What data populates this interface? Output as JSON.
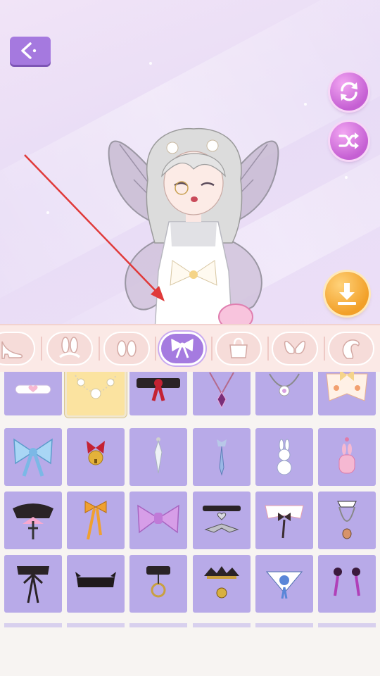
{
  "screen": {
    "back_icon": "back-arrow-icon",
    "buttons": {
      "reset": "refresh-icon",
      "randomize": "shuffle-icon",
      "download": "download-icon"
    }
  },
  "colors": {
    "accent_purple": "#a579df",
    "pink_button": "#d877e0",
    "download_orange": "#f2a028",
    "tab_bar": "#fbe9e6",
    "item_tile": "#b8aae8",
    "item_tile_selected": "#fbe3a0",
    "annotation_arrow": "#e03a3a"
  },
  "categories": [
    {
      "icon": "high-heel-shoe-icon",
      "active": false
    },
    {
      "icon": "bunny-ears-headband-icon",
      "active": false
    },
    {
      "icon": "eyes-icon",
      "active": false
    },
    {
      "icon": "bow-ribbon-icon",
      "active": true
    },
    {
      "icon": "handbag-icon",
      "active": false
    },
    {
      "icon": "wings-icon",
      "active": false
    },
    {
      "icon": "tail-icon",
      "active": false
    }
  ],
  "items": [
    {
      "icon": "heart-choker-icon",
      "selected": false
    },
    {
      "icon": "flower-pearl-necklace-icon",
      "selected": true
    },
    {
      "icon": "black-red-ribbon-choker-icon",
      "selected": false
    },
    {
      "icon": "diamond-pendant-necklace-icon",
      "selected": false
    },
    {
      "icon": "gem-pendant-necklace-icon",
      "selected": false
    },
    {
      "icon": "frilly-collar-bow-icon",
      "selected": false
    },
    {
      "icon": "blue-bow-icon",
      "selected": false
    },
    {
      "icon": "bell-ribbon-icon",
      "selected": false
    },
    {
      "icon": "crystal-drop-icon",
      "selected": false
    },
    {
      "icon": "blue-drop-earring-icon",
      "selected": false
    },
    {
      "icon": "bunny-charm-icon",
      "selected": false
    },
    {
      "icon": "pink-bunny-charm-icon",
      "selected": false
    },
    {
      "icon": "gothic-cross-collar-icon",
      "selected": false
    },
    {
      "icon": "orange-ribbon-icon",
      "selected": false
    },
    {
      "icon": "purple-bow-icon",
      "selected": false
    },
    {
      "icon": "bat-heart-choker-icon",
      "selected": false
    },
    {
      "icon": "lace-collar-bow-icon",
      "selected": false
    },
    {
      "icon": "cameo-necklace-icon",
      "selected": false
    },
    {
      "icon": "black-ribbon-collar-icon",
      "selected": false
    },
    {
      "icon": "black-choker-band-icon",
      "selected": false
    },
    {
      "icon": "ring-choker-icon",
      "selected": false
    },
    {
      "icon": "gold-crown-pendant-icon",
      "selected": false
    },
    {
      "icon": "blue-rose-collar-icon",
      "selected": false
    },
    {
      "icon": "purple-drop-earrings-icon",
      "selected": false
    }
  ]
}
